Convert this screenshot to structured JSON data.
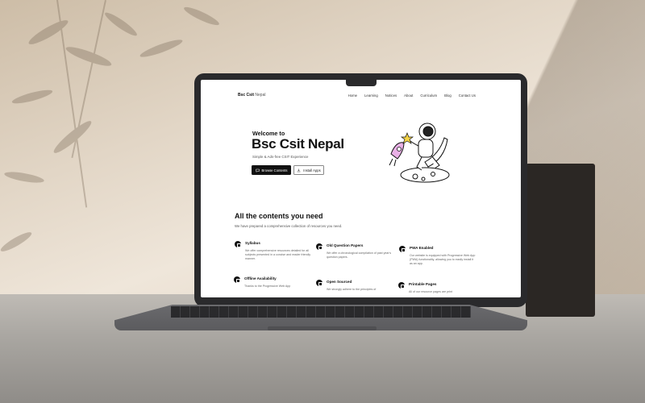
{
  "site": {
    "brand": "Bsc Csit",
    "brand_suffix": "Nepal"
  },
  "nav": {
    "items": [
      "Home",
      "Learning",
      "Notices",
      "About",
      "Curriculum",
      "Blog",
      "Contact Us"
    ]
  },
  "hero": {
    "welcome": "Welcome to",
    "title": "Bsc Csit Nepal",
    "tagline": "Simple & Ads-free CSIT Experience",
    "primary_button": "Browse Contents",
    "secondary_button": "Install Apps"
  },
  "contents": {
    "title": "All the contents you need",
    "subtitle": "We have prepared a comprehensive collection of resources you need.",
    "features": [
      {
        "title": "Syllabus",
        "desc": "We offer comprehensive resources detailed for all subjects presented in a concise and reader friendly manner."
      },
      {
        "title": "Old Question Papers",
        "desc": "We offer a chronological compilation of past year's question papers."
      },
      {
        "title": "PWA Enabled",
        "desc": "Our website is equipped with Progressive Web App (PWA) functionality, allowing you to easily install it as an app."
      },
      {
        "title": "Offline Availability",
        "desc": "Thanks to the Progressive Web App"
      },
      {
        "title": "Open Sourced",
        "desc": "We strongly adhere to the principles of"
      },
      {
        "title": "Printable Pages",
        "desc": "All of our resource pages are print"
      }
    ]
  },
  "icons": {
    "browse": "chat-icon",
    "install": "download-icon",
    "feature": "document-icon"
  }
}
